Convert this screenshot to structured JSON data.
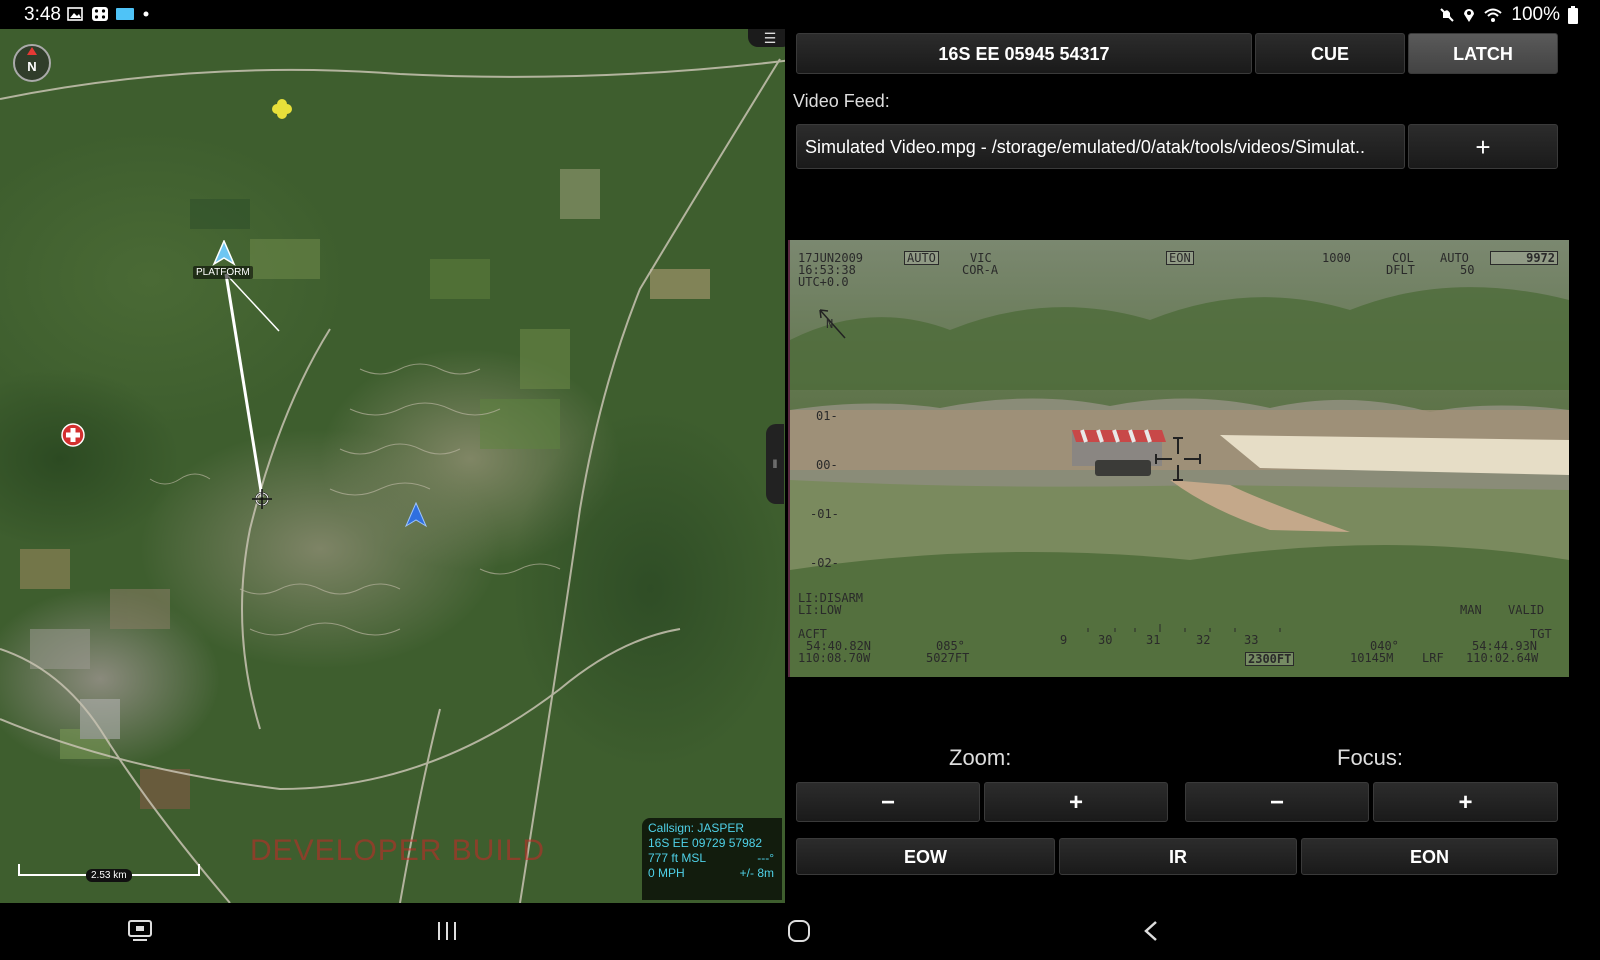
{
  "status_bar": {
    "time": "3:48",
    "left_icons": [
      "image-icon",
      "gamepad-icon",
      "card-icon",
      "dot-icon"
    ],
    "right_icons": [
      "mute-icon",
      "location-icon",
      "wifi-icon"
    ],
    "battery": "100%"
  },
  "map": {
    "menu_icon": "hamburger-icon",
    "compass_label": "N",
    "platform_label": "PLATFORM",
    "watermark": "DEVELOPER BUILD",
    "scale_label": "2.53 km",
    "self_info": {
      "callsign": "Callsign: JASPER",
      "coords": "16S  EE  09729  57982",
      "altitude": "777 ft MSL",
      "heading": "---°",
      "speed": "0 MPH",
      "accuracy": "+/- 8m"
    },
    "colors": {
      "self_marker": "#2f6fe0",
      "platform": "#6ec6f2",
      "hostile_point": "#e8e03a",
      "medical": "#d32f2f"
    }
  },
  "panel": {
    "coord_button": "16S EE 05945 54317",
    "cue_button": "CUE",
    "latch_button": "LATCH",
    "video_feed_label": "Video Feed:",
    "video_feed_value": "Simulated Video.mpg - /storage/emulated/0/atak/tools/videos/Simulat..",
    "add_feed_button": "+",
    "zoom_label": "Zoom:",
    "focus_label": "Focus:",
    "minus": "−",
    "plus": "+",
    "eow_button": "EOW",
    "ir_button": "IR",
    "eon_button": "EON"
  },
  "video_osd": {
    "date": "17JUN2009",
    "time": "16:53:38",
    "utc": "UTC+0.0",
    "auto": "AUTO",
    "vic": "VIC",
    "cor": "COR-A",
    "mode": "EON",
    "range_1000": "1000",
    "col": "COL",
    "dflt": "DFLT",
    "auto2": "AUTO",
    "auto2_val": "50",
    "alt_box": "9972",
    "north": "N",
    "scale_01": "01-",
    "scale_00": "00-",
    "scale_m01": "-01-",
    "scale_m02": "-02-",
    "li1": "LI:DISARM",
    "li2": "LI:LOW",
    "man": "MAN",
    "valid": "VALID",
    "acft": "ACFT",
    "acft_lat": "54:40.82N",
    "acft_lon": "110:08.70W",
    "heading": "085°",
    "alt_ft": "5027FT",
    "tick_9": "9",
    "tick_30": "30",
    "tick_31": "31",
    "tick_32": "32",
    "tick_33": "33",
    "range_box": "2300FT",
    "az": "040°",
    "slant": "10145M",
    "lrf": "LRF",
    "tgt": "TGT",
    "tgt_lat": "54:44.93N",
    "tgt_lon": "110:02.64W"
  },
  "nav_bar": {
    "icons": [
      "recent-screen-icon",
      "recents-icon",
      "home-icon",
      "back-icon"
    ]
  }
}
